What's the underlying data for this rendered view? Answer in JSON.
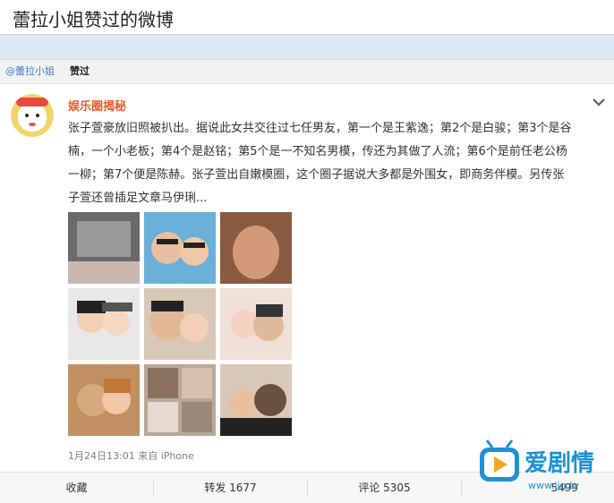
{
  "header": {
    "title": "蕾拉小姐赞过的微博"
  },
  "liker": {
    "name": "@蕾拉小姐",
    "action": "赞过"
  },
  "post": {
    "author": "娱乐圈揭秘",
    "lines": [
      "张子萱豪放旧照被扒出。据说此女共交往过七任男友，第一个是王紫逸；第2个是白骏；第3个是谷",
      "楠，一个小老板；第4个是赵铭；第5个是一不知名男模，传还为其做了人流；第6个是前任老公杨",
      "一柳；第7个便是陈赫。张子萱出自嫩模圈，这个圈子据说大多都是外围女，即商务伴模。另传张",
      "子萱还曾插足文章马伊琍..."
    ],
    "photo_count": 9,
    "timestamp": "1月24日13:01",
    "source_prefix": "来自",
    "source": "iPhone"
  },
  "actions": {
    "favorite": "收藏",
    "repost": "转发 1677",
    "comment": "评论 5305",
    "like": "5499"
  },
  "watermark": {
    "brand": "爱剧情",
    "url": "www.ijq.tv"
  },
  "colors": {
    "author": "#e85c2c",
    "link": "#3f7fbf",
    "page_bg": "#dfe9f3",
    "watermark_blue": "#1e90d6",
    "watermark_orange": "#f5a623"
  },
  "icons": [
    "chevron-down-icon",
    "avatar-cartoon",
    "play-icon"
  ]
}
